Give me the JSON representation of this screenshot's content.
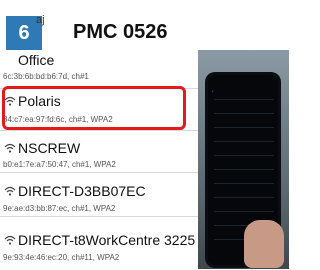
{
  "header": {
    "step_number": "6",
    "doc_code": "PMC 0526",
    "ssid_fragment": "aj"
  },
  "wifi_list": [
    {
      "ssid": "Office",
      "meta": "6c:3b:6b:bd:b6:7d, ch#1"
    },
    {
      "ssid": "Polaris",
      "meta": "84:c7:ea:97:fd:6c, ch#1, WPA2",
      "highlighted": true
    },
    {
      "ssid": "NSCREW",
      "meta": "b0:e1:7e:a7:50:47, ch#1, WPA2"
    },
    {
      "ssid": "DIRECT-D3BB07EC",
      "meta": "9e:ae:d3:bb:87:ec, ch#1, WPA2"
    },
    {
      "ssid": "DIRECT-t8WorkCentre 3225",
      "meta": "9e:93:4e:46:ec:20, ch#11, WPA2"
    }
  ],
  "colors": {
    "badge": "#2f79b5",
    "highlight": "#e3191b"
  },
  "icons": {
    "wifi": "wifi-icon"
  }
}
